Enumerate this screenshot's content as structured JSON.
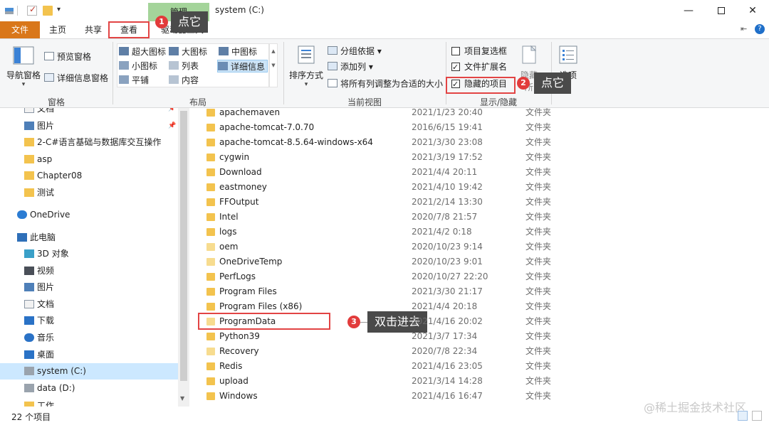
{
  "window": {
    "title": "system (C:)",
    "manage_tab": "管理",
    "drive_tools_tab": "驱动器工具",
    "minimize": "—",
    "close": "✕"
  },
  "tabs": {
    "file": "文件",
    "home": "主页",
    "share": "共享",
    "view": "查看"
  },
  "ribbon": {
    "pane_group": {
      "label": "窗格",
      "nav_pane": "导航窗格",
      "preview_pane": "预览窗格",
      "details_pane": "详细信息窗格"
    },
    "layout_group": {
      "label": "布局",
      "items": [
        "超大图标",
        "大图标",
        "中图标",
        "小图标",
        "列表",
        "详细信息",
        "平铺",
        "内容"
      ],
      "selected": "详细信息"
    },
    "current_view_group": {
      "label": "当前视图",
      "sort_by": "排序方式",
      "group_by": "分组依据",
      "add_column": "添加列",
      "size_all_columns": "将所有列调整为合适的大小"
    },
    "show_hide_group": {
      "label": "显示/隐藏",
      "item_checkboxes": "项目复选框",
      "item_checkboxes_checked": false,
      "file_extensions": "文件扩展名",
      "file_extensions_checked": true,
      "hidden_items": "隐藏的项目",
      "hidden_items_checked": true,
      "hide_selected": "隐藏",
      "hide_selected_suffix": "所"
    },
    "options": "选项"
  },
  "annotations": {
    "step1_badge": "1",
    "step1_text": "点它",
    "step2_badge": "2",
    "step2_text": "点它",
    "step3_badge": "3",
    "step3_text": "双击进去"
  },
  "nav": {
    "items": [
      {
        "label": "文档",
        "icon": "document-icon",
        "pinned": true
      },
      {
        "label": "图片",
        "icon": "pictures-icon",
        "pinned": true
      },
      {
        "label": "2-C#语言基础与数据库交互操作",
        "icon": "folder-icon"
      },
      {
        "label": "asp",
        "icon": "folder-icon"
      },
      {
        "label": "Chapter08",
        "icon": "folder-icon"
      },
      {
        "label": "测试",
        "icon": "folder-icon"
      },
      {
        "label": "OneDrive",
        "icon": "onedrive-icon"
      },
      {
        "label": "此电脑",
        "icon": "pc-icon"
      },
      {
        "label": "3D 对象",
        "icon": "3d-objects-icon"
      },
      {
        "label": "视频",
        "icon": "video-icon"
      },
      {
        "label": "图片",
        "icon": "pictures-icon"
      },
      {
        "label": "文档",
        "icon": "document-icon"
      },
      {
        "label": "下载",
        "icon": "download-icon"
      },
      {
        "label": "音乐",
        "icon": "music-icon"
      },
      {
        "label": "桌面",
        "icon": "desktop-icon"
      },
      {
        "label": "system (C:)",
        "icon": "drive-c-icon",
        "selected": true
      },
      {
        "label": "data (D:)",
        "icon": "drive-d-icon"
      },
      {
        "label": "工作",
        "icon": "folder-icon"
      }
    ]
  },
  "files": [
    {
      "name": "apachemaven",
      "date": "2021/1/23 20:40",
      "type": "文件夹"
    },
    {
      "name": "apache-tomcat-7.0.70",
      "date": "2016/6/15 19:41",
      "type": "文件夹"
    },
    {
      "name": "apache-tomcat-8.5.64-windows-x64",
      "date": "2021/3/30 23:08",
      "type": "文件夹"
    },
    {
      "name": "cygwin",
      "date": "2021/3/19 17:52",
      "type": "文件夹"
    },
    {
      "name": "Download",
      "date": "2021/4/4 20:11",
      "type": "文件夹"
    },
    {
      "name": "eastmoney",
      "date": "2021/4/10 19:42",
      "type": "文件夹"
    },
    {
      "name": "FFOutput",
      "date": "2021/2/14 13:30",
      "type": "文件夹"
    },
    {
      "name": "Intel",
      "date": "2020/7/8 21:57",
      "type": "文件夹"
    },
    {
      "name": "logs",
      "date": "2021/4/2 0:18",
      "type": "文件夹"
    },
    {
      "name": "oem",
      "date": "2020/10/23 9:14",
      "type": "文件夹",
      "hidden": true
    },
    {
      "name": "OneDriveTemp",
      "date": "2020/10/23 9:01",
      "type": "文件夹",
      "hidden": true
    },
    {
      "name": "PerfLogs",
      "date": "2020/10/27 22:20",
      "type": "文件夹"
    },
    {
      "name": "Program Files",
      "date": "2021/3/30 21:17",
      "type": "文件夹"
    },
    {
      "name": "Program Files (x86)",
      "date": "2021/4/4 20:18",
      "type": "文件夹"
    },
    {
      "name": "ProgramData",
      "date": "2021/4/16 20:02",
      "type": "文件夹",
      "hidden": true
    },
    {
      "name": "Python39",
      "date": "2021/3/7 17:34",
      "type": "文件夹"
    },
    {
      "name": "Recovery",
      "date": "2020/7/8 22:34",
      "type": "文件夹",
      "hidden": true
    },
    {
      "name": "Redis",
      "date": "2021/4/16 23:05",
      "type": "文件夹"
    },
    {
      "name": "upload",
      "date": "2021/3/14 14:28",
      "type": "文件夹"
    },
    {
      "name": "Windows",
      "date": "2021/4/16 16:47",
      "type": "文件夹"
    }
  ],
  "status": {
    "item_count": "22 个项目"
  },
  "watermark": "@稀土掘金技术社区"
}
